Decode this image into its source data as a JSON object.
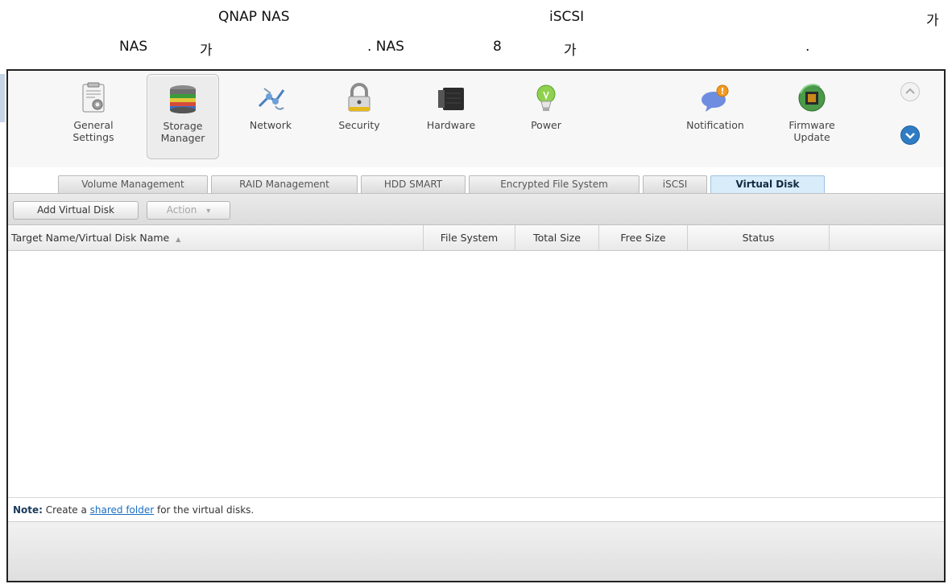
{
  "caption": {
    "line1": {
      "a": "QNAP NAS",
      "b": "iSCSI",
      "c": "가"
    },
    "line2": {
      "a": "NAS",
      "b": "가",
      "c": ". NAS",
      "d": "8",
      "e": "가",
      "f": "."
    }
  },
  "nav": {
    "items": [
      {
        "label_l1": "General",
        "label_l2": "Settings",
        "icon": "general-settings-icon"
      },
      {
        "label_l1": "Storage",
        "label_l2": "Manager",
        "icon": "storage-manager-icon",
        "active": true
      },
      {
        "label_l1": "Network",
        "label_l2": "",
        "icon": "network-icon"
      },
      {
        "label_l1": "Security",
        "label_l2": "",
        "icon": "lock-icon"
      },
      {
        "label_l1": "Hardware",
        "label_l2": "",
        "icon": "hardware-icon"
      },
      {
        "label_l1": "Power",
        "label_l2": "",
        "icon": "power-bulb-icon"
      },
      {
        "label_l1": "Notification",
        "label_l2": "",
        "icon": "notification-icon"
      },
      {
        "label_l1": "Firmware",
        "label_l2": "Update",
        "icon": "firmware-chip-icon"
      }
    ]
  },
  "tabs": [
    {
      "label": "Volume Management"
    },
    {
      "label": "RAID Management"
    },
    {
      "label": "HDD SMART"
    },
    {
      "label": "Encrypted File System"
    },
    {
      "label": "iSCSI"
    },
    {
      "label": "Virtual Disk",
      "active": true
    }
  ],
  "toolbar": {
    "add_label": "Add Virtual Disk",
    "action_label": "Action",
    "action_arrow": "▾"
  },
  "table": {
    "columns": [
      {
        "label": "Target Name/Virtual Disk Name",
        "sort": "▲"
      },
      {
        "label": "File System"
      },
      {
        "label": "Total Size"
      },
      {
        "label": "Free Size"
      },
      {
        "label": "Status"
      }
    ],
    "rows": []
  },
  "note": {
    "prefix": "Note:",
    "text_before": " Create a ",
    "link": "shared folder",
    "text_after": " for the virtual disks."
  },
  "colors": {
    "accent": "#2f7cc4",
    "active_tab_bg": "#d9ecfa",
    "link": "#1a6fc2"
  }
}
